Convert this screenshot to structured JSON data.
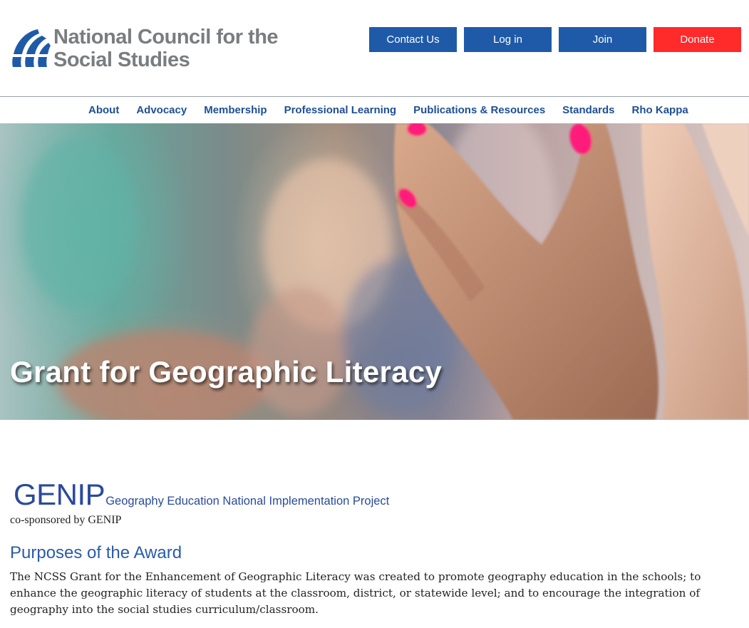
{
  "header": {
    "logo": {
      "line1": "National Council for the",
      "line2": "Social Studies",
      "icon": "globe-icon"
    },
    "buttons": {
      "contact": "Contact Us",
      "login": "Log in",
      "join": "Join",
      "donate": "Donate"
    },
    "colors": {
      "primary_button": "#1f5aa8",
      "donate_button": "#ff2a2a",
      "nav_text": "#1f4f94",
      "logo_text": "#7a7d80"
    }
  },
  "nav": {
    "items": [
      "About",
      "Advocacy",
      "Membership",
      "Professional Learning",
      "Publications & Resources",
      "Standards",
      "Rho Kappa"
    ]
  },
  "hero": {
    "title": "Grant for Geographic Literacy"
  },
  "main": {
    "genip_logo": {
      "acronym": "GENIP",
      "full_name": "Geography Education National Implementation Project"
    },
    "cosponsor": "co-sponsored by GENIP",
    "heading": "Purposes of the Award",
    "paragraph": "The NCSS Grant for the Enhancement of Geographic Literacy was created to promote geography education in the schools; to enhance the geographic literacy of students at the classroom, district, or statewide level; and to encourage the integration of geography into the social studies curriculum/classroom."
  }
}
